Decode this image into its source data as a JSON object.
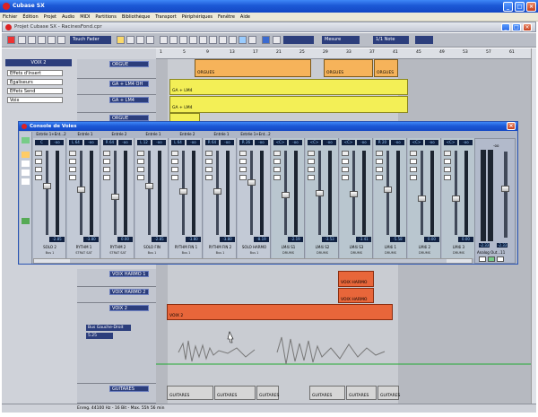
{
  "app": {
    "title": "Cubase SX",
    "project_title": "Projet Cubase SX - RacinesFond.cpr"
  },
  "menu": [
    "Fichier",
    "Édition",
    "Projet",
    "Audio",
    "MIDI",
    "Partitions",
    "Bibliothèque",
    "Transport",
    "Périphériques",
    "Fenêtre",
    "Aide"
  ],
  "toolbar": {
    "touch_mode": "Touch Fader",
    "snap_label": "Mesure",
    "quantize_label": "1/1 Note"
  },
  "ruler": [
    "1",
    "5",
    "9",
    "13",
    "17",
    "21",
    "25",
    "29",
    "33",
    "37",
    "41",
    "45",
    "49",
    "53",
    "57",
    "61"
  ],
  "inspector": {
    "track": "VOIX 2",
    "rows": [
      "Effets d'Insert",
      "Égaliseurs",
      "Effets Send",
      "Voix"
    ]
  },
  "tracks": [
    {
      "name": "ORGUE"
    },
    {
      "name": "GA + LM4 OH"
    },
    {
      "name": "GA + LM4"
    },
    {
      "name": "ORGUE"
    },
    {
      "name": "VOIX HARMO 1"
    },
    {
      "name": "VOIX HARMO 2"
    },
    {
      "name": "VOIX 2"
    },
    {
      "name": "GUITARES"
    }
  ],
  "track_details": {
    "routing": "Bus Gauche-Droit",
    "value": "5.25"
  },
  "parts": {
    "orgue": [
      "ORGUES",
      "ORGUES",
      "ORGUES"
    ],
    "ga": [
      "GA + LM4",
      "GA + LM4"
    ],
    "voix_harmo": [
      "VOIX HARMO",
      "VOIX HARMO"
    ],
    "voix2": "VOIX 2",
    "guitares": [
      "GUITARES",
      "GUITARES",
      "GUITARES",
      "GUITARES",
      "GUITARES",
      "GUITARES"
    ]
  },
  "console": {
    "title": "Console de Voies",
    "inserts": [
      "Entrée 1+Ent...2",
      "Entrée 1",
      "Entrée 2",
      "Entrée 1",
      "Entrée 2",
      "Entrée 1",
      "Entrée 1+Ent...2"
    ],
    "channels": [
      {
        "pan": "C",
        "vol": "-2.85",
        "name": "SOLO 2",
        "out": "Bus 1",
        "fader": 0.55
      },
      {
        "pan": "L 64",
        "vol": "-3.80",
        "name": "RYTHM 1",
        "out": "STRAT SAT",
        "fader": 0.5
      },
      {
        "pan": "R 64",
        "vol": "0.00",
        "name": "RYTHM 2",
        "out": "STRAT SAT",
        "fader": 0.4
      },
      {
        "pan": "L 12",
        "vol": "-2.85",
        "name": "SOLO FIN",
        "out": "Bus 1",
        "fader": 0.55
      },
      {
        "pan": "L 64",
        "vol": "-3.80",
        "name": "RYTHM FIN 1",
        "out": "Bus 1",
        "fader": 0.48
      },
      {
        "pan": "R 64",
        "vol": "-3.80",
        "name": "RYTHM FIN 2",
        "out": "Bus 1",
        "fader": 0.48
      },
      {
        "pan": "R 26",
        "vol": "-8.19",
        "name": "SOLO HARMO",
        "out": "Bus 1",
        "fader": 0.6
      },
      {
        "pan": "<C>",
        "vol": "-2.19",
        "name": "LM4i S1",
        "out": "DRUMS",
        "fader": 0.42
      },
      {
        "pan": "<C>",
        "vol": "-3.53",
        "name": "LM4i S2",
        "out": "DRUMS",
        "fader": 0.45
      },
      {
        "pan": "<C>",
        "vol": "-3.41",
        "name": "LM4i S3",
        "out": "DRUMS",
        "fader": 0.44
      },
      {
        "pan": "R 20",
        "vol": "-5.58",
        "name": "LM4i 1",
        "out": "DRUMS",
        "fader": 0.5
      },
      {
        "pan": "<C>",
        "vol": "0.00",
        "name": "LM4i 2",
        "out": "DRUMS",
        "fader": 0.38
      },
      {
        "pan": "<C>",
        "vol": "0.00",
        "name": "LM4i 3",
        "out": "DRUMS",
        "fader": 0.38
      }
    ],
    "master": {
      "name": "Analog Out...11",
      "vol1": "-2.33",
      "vol2": "-2.33",
      "meter_top": "-oo"
    }
  },
  "status": {
    "record": "Enreg. 44100 Hz - 16 Bit - Max. 55h 56 min"
  },
  "colors": {
    "orange_part": "#f6b35a",
    "yellow_part": "#f3ef56",
    "red_part": "#e8663a",
    "title_blue": "#1c58d6"
  }
}
